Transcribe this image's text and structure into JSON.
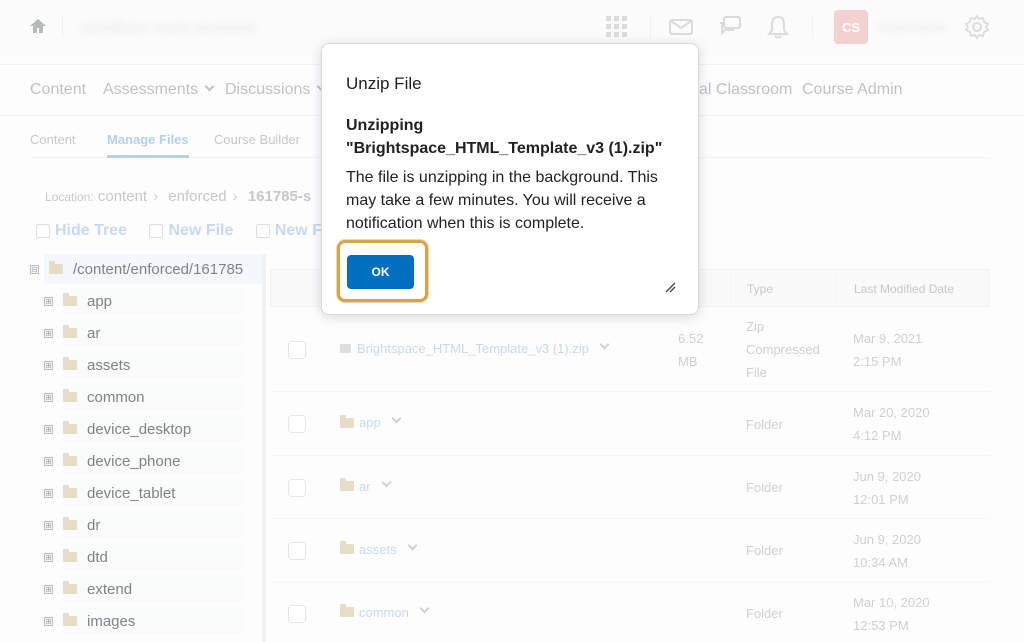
{
  "minibar": {
    "org_name": "sandbox-nuro-avewell",
    "avatar_initials": "CS",
    "user_name": "Username"
  },
  "nav": {
    "items": [
      "Content",
      "Assessments",
      "Discussions",
      "al Classroom",
      "Course Admin"
    ]
  },
  "subtabs": {
    "items": [
      "Content",
      "Manage Files",
      "Course Builder"
    ],
    "active": "Manage Files"
  },
  "location": {
    "label": "Location:",
    "crumbs": [
      "content",
      "enforced",
      "161785-s"
    ]
  },
  "toolbar": {
    "hide_tree": "Hide Tree",
    "new_file": "New File",
    "new_folder": "New Fo"
  },
  "tree": {
    "root": "/content/enforced/161785",
    "expander_symbol": "⊟",
    "collapsed_symbol": "⊞",
    "items": [
      "app",
      "ar",
      "assets",
      "common",
      "device_desktop",
      "device_phone",
      "device_tablet",
      "dr",
      "dtd",
      "extend",
      "images"
    ]
  },
  "table": {
    "headers": {
      "type": "Type",
      "modified": "Last Modified Date"
    },
    "rows": [
      {
        "name": "Brightspace_HTML_Template_v3 (1).zip",
        "size": "6.52 MB",
        "type": "Zip Compressed File",
        "date": "Mar 9, 2021 2:15 PM",
        "kind": "zip"
      },
      {
        "name": "app",
        "size": "",
        "type": "Folder",
        "date": "Mar 20, 2020 4:12 PM",
        "kind": "folder"
      },
      {
        "name": "ar",
        "size": "",
        "type": "Folder",
        "date": "Jun 9, 2020 12:01 PM",
        "kind": "folder"
      },
      {
        "name": "assets",
        "size": "",
        "type": "Folder",
        "date": "Jun 9, 2020 10:34 AM",
        "kind": "folder"
      },
      {
        "name": "common",
        "size": "",
        "type": "Folder",
        "date": "Mar 10, 2020 12:53 PM",
        "kind": "folder"
      }
    ]
  },
  "dialog": {
    "title": "Unzip File",
    "heading": "Unzipping \"Brightspace_HTML_Template_v3 (1).zip\"",
    "body": "The file is unzipping in the background. This may take a few minutes. You will receive a notification when this is complete.",
    "ok_label": "OK"
  },
  "colors": {
    "primary_button": "#006fbf",
    "focus_ring": "#d6a44a",
    "link": "#8fb3d7",
    "avatar": "#e7a3a1"
  }
}
